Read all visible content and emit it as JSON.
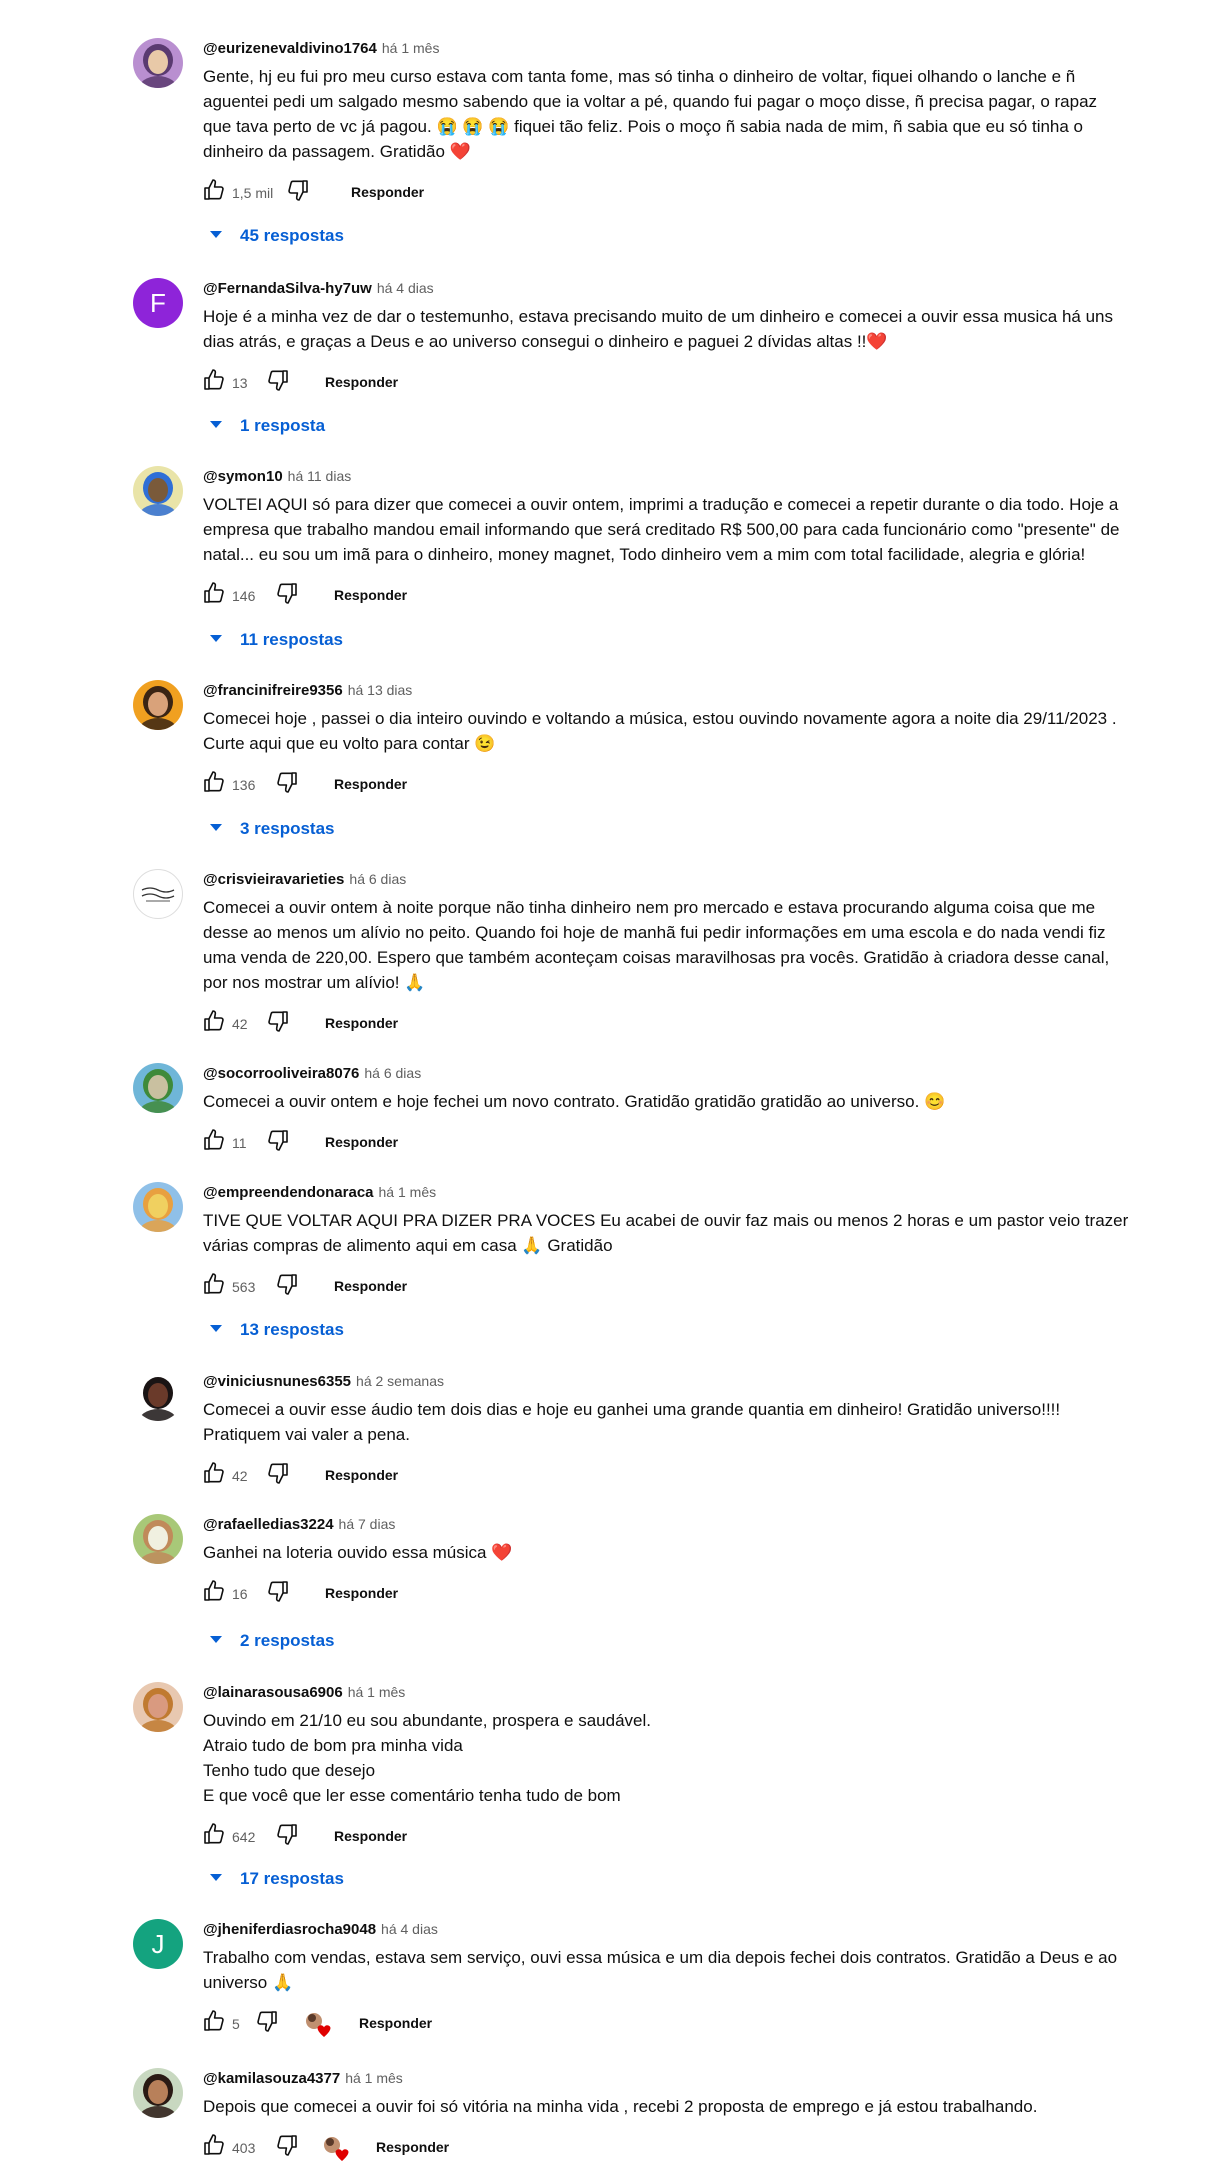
{
  "reply_label": "Responder",
  "comments": [
    {
      "author": "@eurizenevaldivino1764",
      "time": "há 1 mês",
      "text": "Gente, hj eu fui pro meu curso estava com tanta fome, mas só tinha o dinheiro de voltar, fiquei olhando o lanche e ñ\naguentei pedi um salgado  mesmo sabendo que ia voltar  a pé, quando fui pagar o moço disse, ñ precisa pagar, o rapaz\nque tava perto de vc já pagou. 😭 😭 😭  fiquei tão feliz. Pois o moço ñ sabia nada de mim, ñ sabia que eu só tinha o\ndinheiro da passagem. Gratidão ❤️",
      "likes": "1,5 mil",
      "replies": "45 respostas",
      "avatar": {
        "type": "photo",
        "colors": [
          "#b98fd0",
          "#5a3a70",
          "#e8c9a8"
        ]
      }
    },
    {
      "author": "@FernandaSilva-hy7uw",
      "time": "há 4 dias",
      "text": "Hoje é a minha vez de dar o testemunho, estava precisando muito de um dinheiro e comecei a ouvir essa musica há uns\ndias atrás, e graças a Deus e ao universo consegui o dinheiro e paguei 2 dívidas altas !!❤️",
      "likes": "13",
      "replies": "1 resposta",
      "avatar": {
        "type": "letter",
        "letter": "F",
        "color": "#8e24d9"
      }
    },
    {
      "author": "@symon10",
      "time": "há 11 dias",
      "text": "VOLTEI AQUI só para dizer que comecei a ouvir ontem, imprimi a tradução e comecei a repetir durante o dia todo. Hoje a\nempresa que trabalho mandou email informando que será creditado R$ 500,00 para cada funcionário como \"presente\" de\nnatal... eu sou um imã para o dinheiro, money magnet, Todo dinheiro vem a mim com total facilidade, alegria e glória!",
      "likes": "146",
      "replies": "11 respostas",
      "avatar": {
        "type": "photo",
        "colors": [
          "#e9e4a8",
          "#2f6fd6",
          "#7a5a3a"
        ]
      }
    },
    {
      "author": "@francinifreire9356",
      "time": "há 13 dias",
      "text": "Comecei hoje , passei o dia inteiro ouvindo e voltando a música,  estou ouvindo novamente agora a noite dia 29/11/2023 .\nCurte aqui que eu volto para contar 😉",
      "likes": "136",
      "replies": "3 respostas",
      "avatar": {
        "type": "photo",
        "colors": [
          "#f0a020",
          "#3a2414",
          "#d9a27a"
        ]
      }
    },
    {
      "author": "@crisvieiravarieties",
      "time": "há 6 dias",
      "text": "Comecei a ouvir ontem à noite porque não tinha dinheiro nem pro mercado e estava procurando alguma coisa que me\ndesse ao menos um alívio no peito. Quando foi hoje de manhã fui pedir informações em uma escola e do nada vendi fiz\numa venda de 220,00. Espero que também aconteçam coisas maravilhosas pra vocês. Gratidão à criadora desse canal,\npor nos mostrar um alívio! 🙏",
      "likes": "42",
      "replies": "",
      "avatar": {
        "type": "logo"
      }
    },
    {
      "author": "@socorrooliveira8076",
      "time": "há 6 dias",
      "text": "Comecei a ouvir ontem e hoje fechei um novo contrato. Gratidão gratidão gratidão ao universo. 😊",
      "likes": "11",
      "replies": "",
      "avatar": {
        "type": "photo",
        "colors": [
          "#6fb6d8",
          "#3f8a3a",
          "#c9c0a0"
        ]
      }
    },
    {
      "author": "@empreendendonaraca",
      "time": "há 1 mês",
      "text": "TIVE QUE VOLTAR AQUI PRA DIZER PRA VOCES Eu acabei de ouvir faz mais ou menos 2 horas e um pastor veio trazer\nvárias compras de alimento aqui em casa 🙏 Gratidão",
      "likes": "563",
      "replies": "13 respostas",
      "avatar": {
        "type": "photo",
        "colors": [
          "#8fc0e8",
          "#e8a040",
          "#f0d060"
        ]
      }
    },
    {
      "author": "@viniciusnunes6355",
      "time": "há 2 semanas",
      "text": "Comecei a ouvir esse áudio tem dois dias e hoje eu ganhei uma grande quantia em dinheiro! Gratidão universo!!!!\nPratiquem vai valer a pena.",
      "likes": "42",
      "replies": "",
      "avatar": {
        "type": "photo",
        "colors": [
          "#ffffff",
          "#1a1414",
          "#6a3a2a"
        ]
      }
    },
    {
      "author": "@rafaelledias3224",
      "time": "há 7 dias",
      "text": "Ganhei na loteria ouvido essa música ❤️",
      "likes": "16",
      "replies": "2 respostas",
      "avatar": {
        "type": "photo",
        "colors": [
          "#a8c878",
          "#c08a5a",
          "#f0f0e0"
        ]
      }
    },
    {
      "author": "@lainarasousa6906",
      "time": "há 1 mês",
      "text": "Ouvindo em 21/10 eu sou abundante, prospera e saudável.\nAtraio tudo de bom pra minha vida\nTenho tudo que desejo\nE que você que ler esse comentário tenha tudo de bom",
      "likes": "642",
      "replies": "17 respostas",
      "avatar": {
        "type": "photo",
        "colors": [
          "#e8c8b0",
          "#c07a30",
          "#d99a80"
        ]
      }
    },
    {
      "author": "@jheniferdiasrocha9048",
      "time": "há 4 dias",
      "text": "Trabalho com vendas, estava sem serviço, ouvi essa música  e um dia depois fechei dois contratos. Gratidão a Deus e ao\nuniverso 🙏",
      "likes": "5",
      "replies": "",
      "creator_heart": true,
      "avatar": {
        "type": "letter",
        "letter": "J",
        "color": "#14a37f"
      }
    },
    {
      "author": "@kamilasouza4377",
      "time": "há 1 mês",
      "text": "Depois que comecei a ouvir foi só vitória na minha vida , recebi 2 proposta de emprego e já estou trabalhando.",
      "likes": "403",
      "replies": "",
      "creator_heart": true,
      "avatar": {
        "type": "photo",
        "colors": [
          "#c8d8c0",
          "#2a1a14",
          "#b8805a"
        ]
      }
    }
  ]
}
